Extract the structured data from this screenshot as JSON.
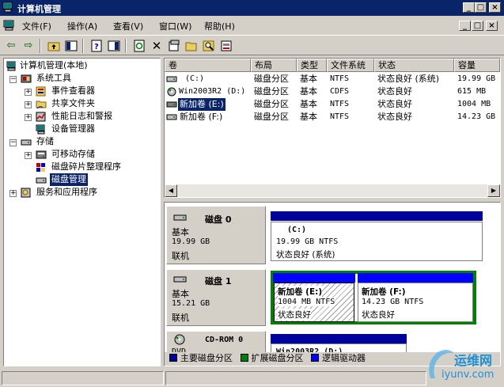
{
  "window": {
    "title": "计算机管理"
  },
  "menu": [
    "文件(F)",
    "操作(A)",
    "查看(V)",
    "窗口(W)",
    "帮助(H)"
  ],
  "caption_buttons": {
    "minimize": "_",
    "maximize": "□",
    "close": "×"
  },
  "tree": {
    "root": "计算机管理(本地)",
    "items": [
      {
        "label": "系统工具"
      },
      {
        "label": "事件查看器"
      },
      {
        "label": "共享文件夹"
      },
      {
        "label": "性能日志和警报"
      },
      {
        "label": "设备管理器"
      },
      {
        "label": "存储"
      },
      {
        "label": "可移动存储"
      },
      {
        "label": "磁盘碎片整理程序"
      },
      {
        "label": "磁盘管理"
      },
      {
        "label": "服务和应用程序"
      }
    ]
  },
  "volume_list": {
    "columns": [
      "卷",
      "布局",
      "类型",
      "文件系统",
      "状态",
      "容量"
    ],
    "rows": [
      [
        "(C:)",
        "磁盘分区",
        "基本",
        "NTFS",
        "状态良好 (系统)",
        "19.99 GB"
      ],
      [
        "Win2003R2 (D:)",
        "磁盘分区",
        "基本",
        "CDFS",
        "状态良好",
        "615 MB"
      ],
      [
        "新加卷 (E:)",
        "磁盘分区",
        "基本",
        "NTFS",
        "状态良好",
        "1004 MB"
      ],
      [
        "新加卷 (F:)",
        "磁盘分区",
        "基本",
        "NTFS",
        "状态良好",
        "14.23 GB"
      ]
    ]
  },
  "disks": [
    {
      "name": "磁盘 0",
      "type": "基本",
      "size": "19.99 GB",
      "status": "联机",
      "volumes": [
        {
          "name": "(C:)",
          "detail": "19.99 GB NTFS",
          "status": "状态良好 (系统)"
        }
      ]
    },
    {
      "name": "磁盘 1",
      "type": "基本",
      "size": "15.21 GB",
      "status": "联机",
      "volumes": [
        {
          "name": "新加卷  (E:)",
          "detail": "1004 MB NTFS",
          "status": "状态良好"
        },
        {
          "name": "新加卷  (F:)",
          "detail": "14.23 GB NTFS",
          "status": "状态良好"
        }
      ]
    },
    {
      "name": "CD-ROM 0",
      "type": "DVD",
      "volumes": [
        {
          "name": "Win2003R2  (D:)"
        }
      ]
    }
  ],
  "legend": [
    {
      "label": "主要磁盘分区",
      "color": "#00009c"
    },
    {
      "label": "扩展磁盘分区",
      "color": "#008000"
    },
    {
      "label": "逻辑驱动器",
      "color": "#0000ff"
    }
  ],
  "watermark": {
    "text1": "运维网",
    "text2": "iyunv.com"
  }
}
